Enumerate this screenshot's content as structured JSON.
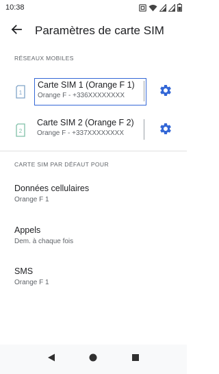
{
  "status_bar": {
    "time": "10:38",
    "icons": [
      "nfc-icon",
      "wifi-icon",
      "signal-icon",
      "signal-icon",
      "battery-icon"
    ]
  },
  "app_bar": {
    "back_icon": "arrow-back-icon",
    "title": "Paramètres de carte SIM"
  },
  "mobile_networks": {
    "header": "RÉSEAUX MOBILES",
    "sims": [
      {
        "icon_label": "1",
        "title": "Carte SIM 1 (Orange F 1)",
        "summary": "Orange F - +336XXXXXXXX",
        "icon_color": "#7fa3c8",
        "focused": true,
        "settings_icon": "gear-icon"
      },
      {
        "icon_label": "2",
        "title": "Carte SIM 2 (Orange F 2)",
        "summary": "Orange F - +337XXXXXXXX",
        "icon_color": "#7fbfa8",
        "focused": false,
        "settings_icon": "gear-icon"
      }
    ]
  },
  "default_sim": {
    "header": "CARTE SIM PAR DÉFAUT POUR",
    "items": [
      {
        "title": "Données cellulaires",
        "summary": "Orange F 1"
      },
      {
        "title": "Appels",
        "summary": "Dem. à chaque fois"
      },
      {
        "title": "SMS",
        "summary": "Orange F 1"
      }
    ]
  },
  "nav_bar": {
    "back": "triangle-back-icon",
    "home": "circle-home-icon",
    "recents": "square-recents-icon"
  },
  "colors": {
    "accent": "#3367d6",
    "text_primary": "#202124",
    "text_secondary": "#5f6368"
  }
}
